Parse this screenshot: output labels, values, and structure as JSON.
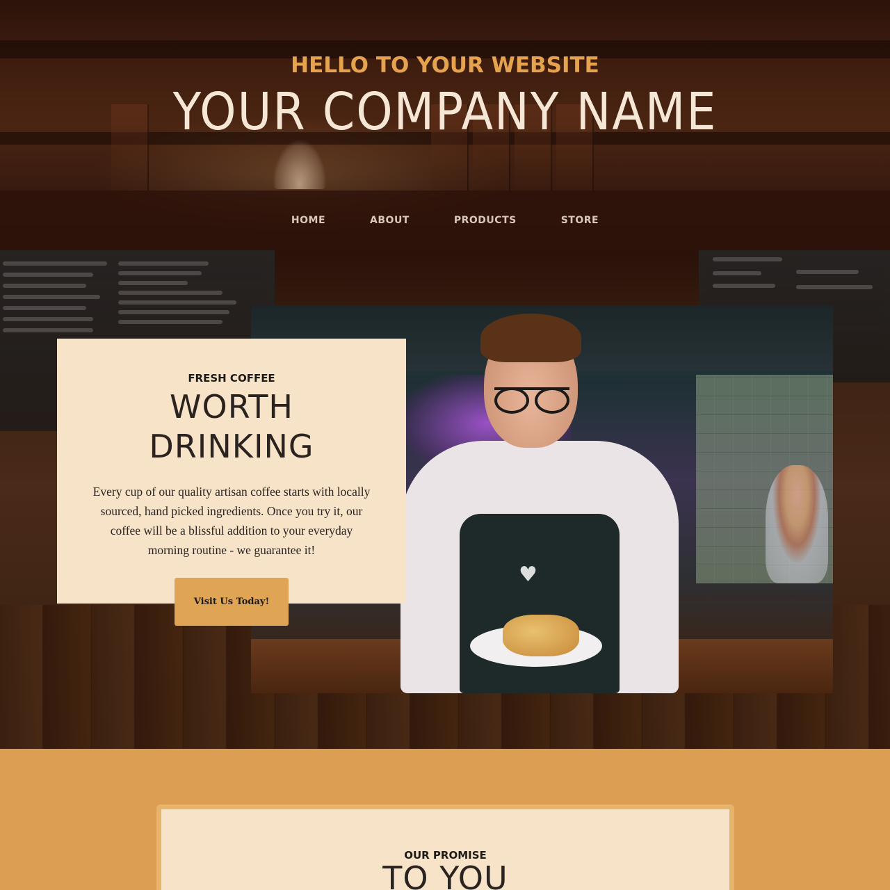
{
  "header": {
    "tagline": "HELLO TO YOUR WEBSITE",
    "company_name": "YOUR COMPANY NAME"
  },
  "nav": {
    "items": [
      {
        "label": "HOME"
      },
      {
        "label": "ABOUT"
      },
      {
        "label": "PRODUCTS"
      },
      {
        "label": "STORE"
      }
    ]
  },
  "hero": {
    "eyebrow": "FRESH COFFEE",
    "headline_line1": "WORTH",
    "headline_line2": "DRINKING",
    "body": "Every cup of our quality artisan coffee starts with locally sourced, hand picked ingredients. Once you try it, our coffee will be a blissful addition to your everyday morning routine - we guarantee it!",
    "cta_label": "Visit Us Today!"
  },
  "promise": {
    "eyebrow": "OUR PROMISE",
    "headline": "TO YOU"
  },
  "colors": {
    "accent": "#e0a455",
    "tagline": "#e6a34f",
    "card_bg": "#f6e3c8",
    "nav_bg": "#2d120a",
    "section_bg": "#dc9e52"
  },
  "icons": {
    "apron_logo": "heart-icon"
  }
}
